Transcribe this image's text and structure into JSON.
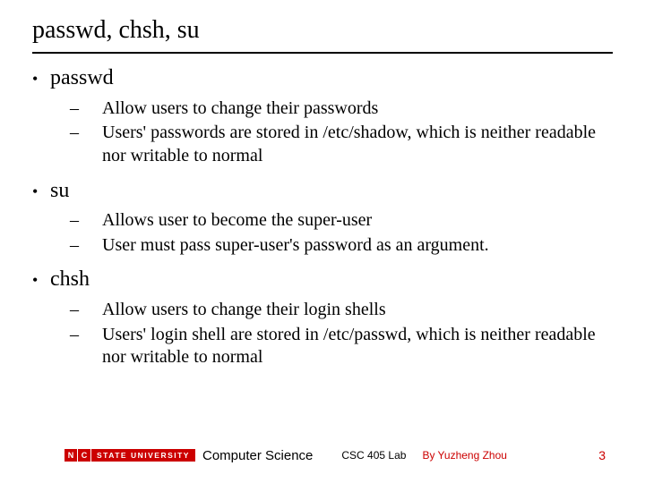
{
  "title": "passwd, chsh, su",
  "bullets": [
    {
      "head": "passwd",
      "subs": [
        "Allow users to change their passwords",
        "Users' passwords are stored in /etc/shadow, which is neither readable nor writable to normal"
      ]
    },
    {
      "head": "su",
      "subs": [
        "Allows user to become the super-user",
        "User must pass super-user's password as an argument."
      ]
    },
    {
      "head": "chsh",
      "subs": [
        "Allow users to change their login shells",
        "Users' login shell are stored in /etc/passwd, which is neither readable nor writable to normal"
      ]
    }
  ],
  "footer": {
    "logo_letters": {
      "n": "N",
      "c": "C"
    },
    "logo_text": "STATE UNIVERSITY",
    "dept": "Computer Science",
    "course": "CSC 405 Lab",
    "author": "By Yuzheng Zhou",
    "page": "3"
  }
}
